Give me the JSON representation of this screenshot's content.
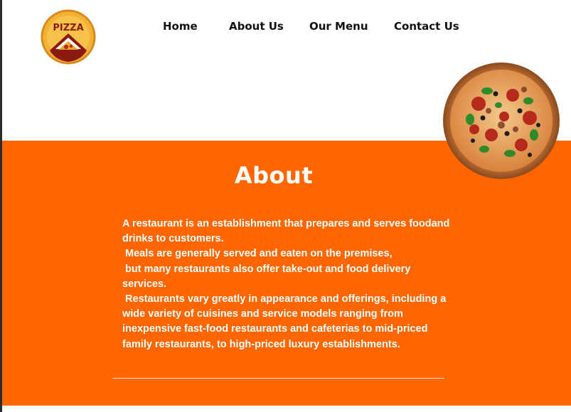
{
  "logo": {
    "text": "PIZZA",
    "icon": "pizza-logo-icon"
  },
  "nav": {
    "items": [
      {
        "label": "Home"
      },
      {
        "label": "About Us"
      },
      {
        "label": "Our Menu"
      },
      {
        "label": "Contact Us"
      }
    ]
  },
  "hero": {
    "image": "pizza-image"
  },
  "about": {
    "title": "About",
    "lines": [
      "A restaurant is an establishment that prepares and serves foodand",
      "drinks to customers.",
      " Meals are generally served and eaten on the premises,",
      " but many restaurants also offer take-out and food delivery",
      "services.",
      " Restaurants vary greatly in appearance and offerings, including a",
      "wide variety of cuisines and service models ranging from",
      "inexpensive fast-food restaurants and cafeterias to mid-priced",
      "family restaurants, to high-priced luxury establishments."
    ]
  },
  "colors": {
    "accent": "#ff6600",
    "text_on_accent": "#ffffff",
    "nav_text": "#111111"
  }
}
